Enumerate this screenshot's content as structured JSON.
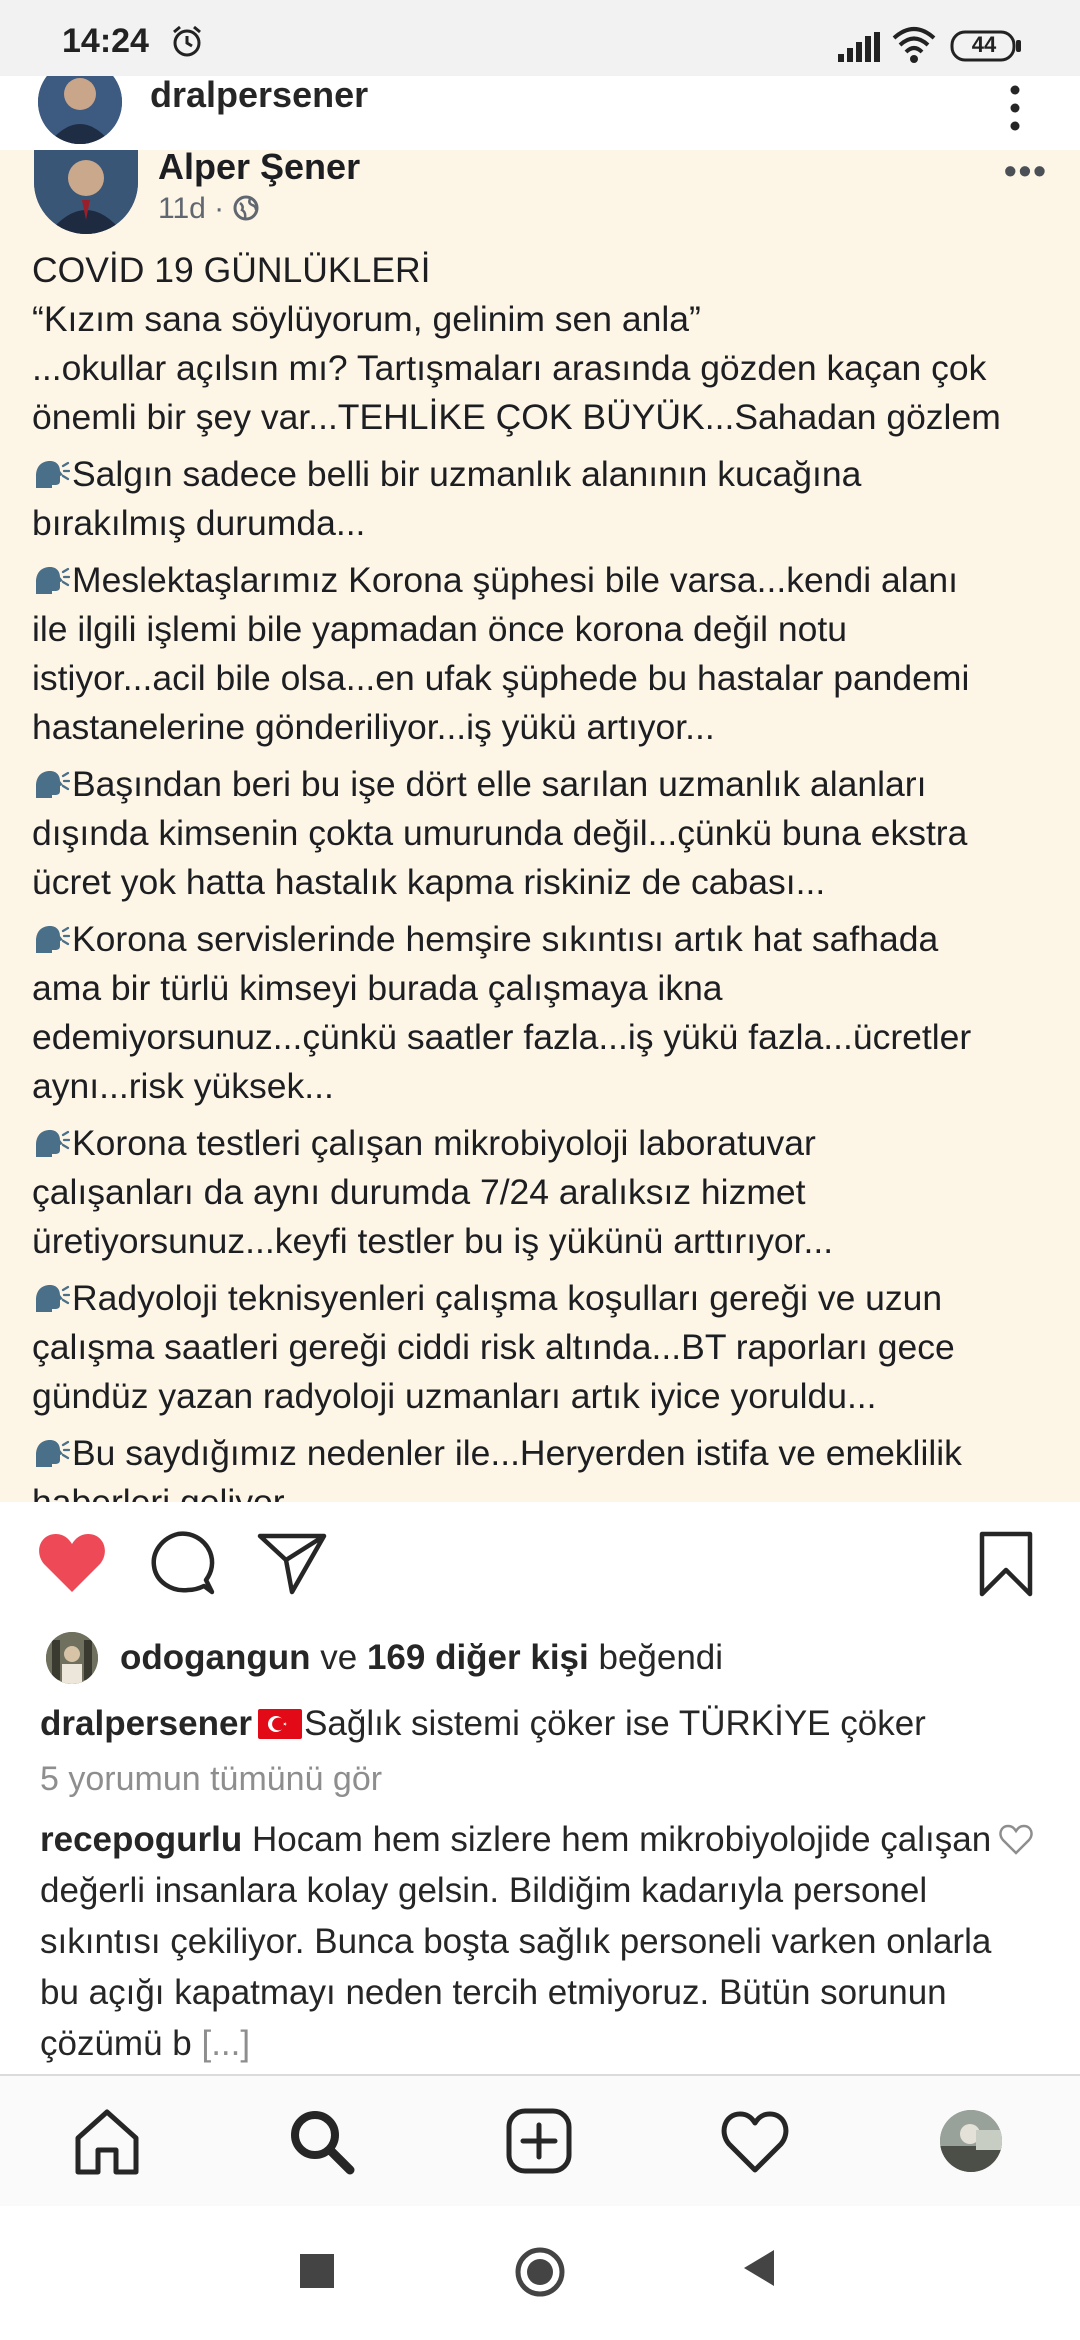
{
  "status_bar": {
    "time": "14:24",
    "battery": "44",
    "icons": [
      "alarm-icon",
      "signal-icon",
      "wifi-icon",
      "battery-icon"
    ]
  },
  "post": {
    "username": "dralpersener",
    "image": {
      "author": "Alper Şener",
      "meta": "11d ·",
      "paragraphs": [
        {
          "bullet": false,
          "lines": [
            "COVİD 19 GÜNLÜKLERİ",
            "“Kızım sana söylüyorum, gelinim sen anla”",
            "...okullar açılsın mı? Tartışmaları arasında gözden kaçan çok",
            "önemli bir şey var...TEHLİKE ÇOK BÜYÜK...Sahadan gözlem"
          ]
        },
        {
          "bullet": true,
          "lines": [
            "Salgın sadece belli bir uzmanlık alanının  kucağına",
            "bırakılmış durumda..."
          ]
        },
        {
          "bullet": true,
          "lines": [
            "Meslektaşlarımız Korona şüphesi bile varsa...kendi alanı",
            "ile ilgili işlemi bile yapmadan önce korona değil notu",
            "istiyor...acil bile olsa...en ufak şüphede bu hastalar pandemi",
            "hastanelerine gönderiliyor...iş yükü artıyor..."
          ]
        },
        {
          "bullet": true,
          "lines": [
            "Başından beri bu işe dört elle sarılan uzmanlık alanları",
            "dışında kimsenin çokta umurunda değil...çünkü buna ekstra",
            "ücret yok hatta hastalık kapma riskiniz de cabası..."
          ]
        },
        {
          "bullet": true,
          "lines": [
            "Korona servislerinde hemşire sıkıntısı artık hat safhada",
            "ama bir türlü kimseyi burada çalışmaya ikna",
            "edemiyorsunuz...çünkü saatler fazla...iş yükü fazla...ücretler",
            "aynı...risk yüksek..."
          ]
        },
        {
          "bullet": true,
          "lines": [
            "Korona testleri çalışan mikrobiyoloji laboratuvar",
            "çalışanları da aynı durumda 7/24 aralıksız hizmet",
            "üretiyorsunuz...keyfi testler bu iş yükünü arttırıyor..."
          ]
        },
        {
          "bullet": true,
          "lines": [
            "Radyoloji teknisyenleri çalışma koşulları gereği ve uzun",
            "çalışma saatleri gereği ciddi risk altında...BT raporları gece",
            "gündüz yazan radyoloji uzmanları artık iyice yoruldu..."
          ]
        },
        {
          "bullet": true,
          "lines": [
            "Bu saydığımız nedenler ile...Heryerden istifa ve emeklilik",
            "haberleri geliyor..."
          ]
        }
      ]
    },
    "likes": {
      "user": "odogangun",
      "connector": "ve",
      "others": "169 diğer kişi",
      "suffix": "beğendi"
    },
    "caption": {
      "user": "dralpersener",
      "text": "Sağlık sistemi çöker ise TÜRKİYE çöker"
    },
    "view_comments": "5 yorumun tümünü gör",
    "comment": {
      "user": "recepogurlu",
      "text": "Hocam hem sizlere hem mikrobiyolojide çalışan değerli insanlara kolay gelsin. Bildiğim kadarıyla personel sıkıntısı çekiliyor. Bunca boşta sağlık personeli varken onlarla bu açığı kapatmayı neden tercih etmiyoruz. Bütün sorunun çözümü b",
      "more": "[...]"
    }
  },
  "colors": {
    "like_red": "#ed4956",
    "image_bg": "#fdf5e6",
    "muted": "#8e8e8e"
  }
}
